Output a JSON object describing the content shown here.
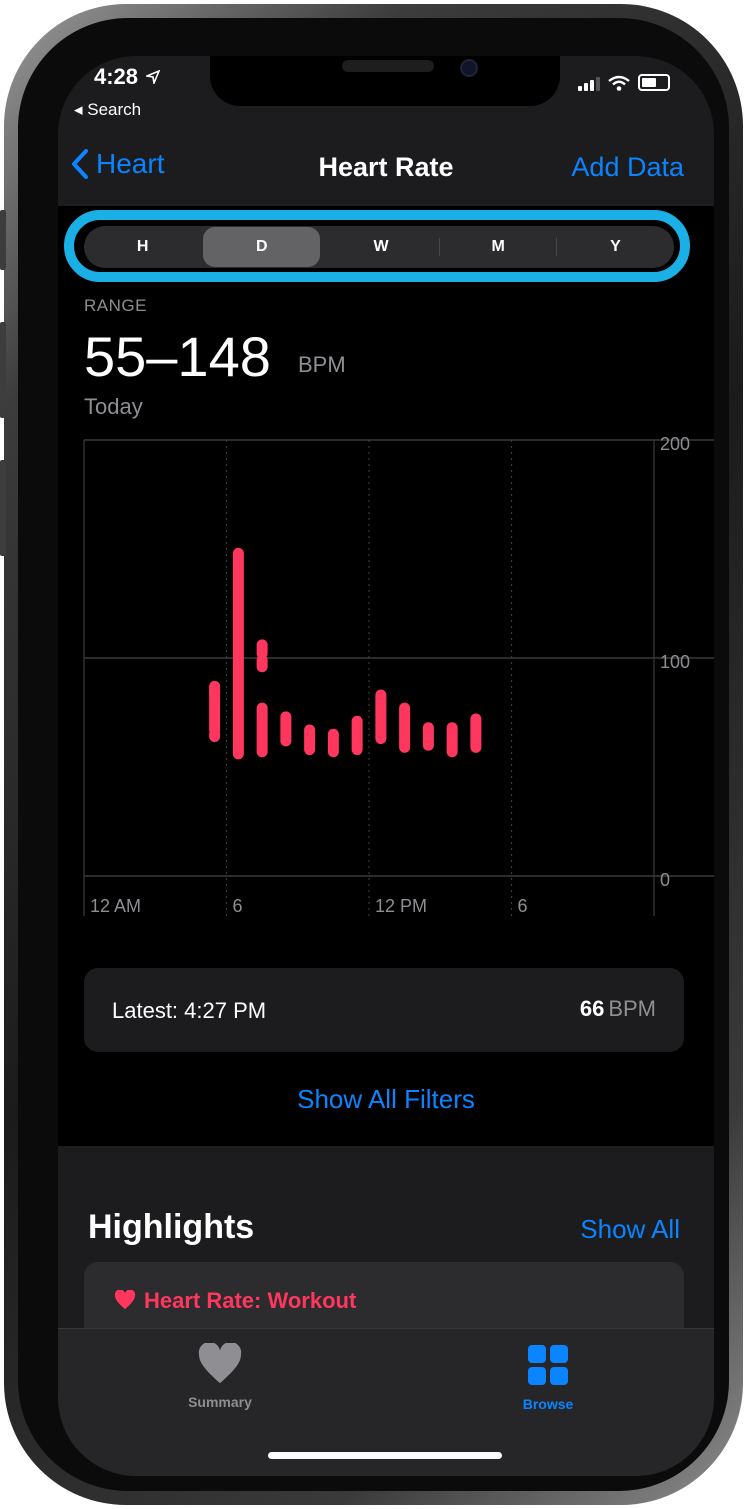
{
  "status_bar": {
    "time": "4:28",
    "back_label": "◂ Search"
  },
  "nav": {
    "back_label": "Heart",
    "title": "Heart Rate",
    "action_label": "Add Data"
  },
  "segments": {
    "items": [
      "H",
      "D",
      "W",
      "M",
      "Y"
    ],
    "selected": "D",
    "highlight_color": "#1ab0e6"
  },
  "summary": {
    "label": "RANGE",
    "value": "55–148",
    "unit": "BPM",
    "date": "Today"
  },
  "chart_data": {
    "type": "range-bar",
    "x_tick_labels": [
      "12 AM",
      "6",
      "12 PM",
      "6"
    ],
    "y_tick_labels": [
      "200",
      "100",
      "0"
    ],
    "ylim": [
      0,
      200
    ],
    "grid": true,
    "series_color": "#ff375f",
    "bars": [
      {
        "hour": 5.5,
        "low": 85,
        "high": 84
      },
      {
        "hour": 5.5,
        "low": 65,
        "high": 64
      },
      {
        "hour": 5.5,
        "low": 67,
        "high": 87
      },
      {
        "hour": 6.5,
        "low": 56,
        "high": 148
      },
      {
        "hour": 7.5,
        "low": 102,
        "high": 106
      },
      {
        "hour": 7.5,
        "low": 96,
        "high": 99
      },
      {
        "hour": 7.5,
        "low": 57,
        "high": 77
      },
      {
        "hour": 8.5,
        "low": 62,
        "high": 73
      },
      {
        "hour": 9.5,
        "low": 58,
        "high": 67
      },
      {
        "hour": 10.5,
        "low": 57,
        "high": 65
      },
      {
        "hour": 11.5,
        "low": 58,
        "high": 71
      },
      {
        "hour": 12.5,
        "low": 63,
        "high": 83
      },
      {
        "hour": 13.5,
        "low": 59,
        "high": 77
      },
      {
        "hour": 14.5,
        "low": 60,
        "high": 68
      },
      {
        "hour": 15.5,
        "low": 57,
        "high": 68
      },
      {
        "hour": 16.5,
        "low": 59,
        "high": 72
      }
    ]
  },
  "latest": {
    "label": "Latest: 4:27 PM",
    "value": "66",
    "unit": "BPM"
  },
  "filters_link": "Show All Filters",
  "highlights": {
    "title": "Highlights",
    "show_all": "Show All",
    "card_title": "Heart Rate: Workout"
  },
  "tabs": [
    {
      "label": "Summary",
      "icon": "heart-icon",
      "active": false
    },
    {
      "label": "Browse",
      "icon": "grid-icon",
      "active": true
    }
  ],
  "colors": {
    "accent": "#0a84ff",
    "heart": "#ff375f",
    "inactive": "#8e8e93"
  }
}
